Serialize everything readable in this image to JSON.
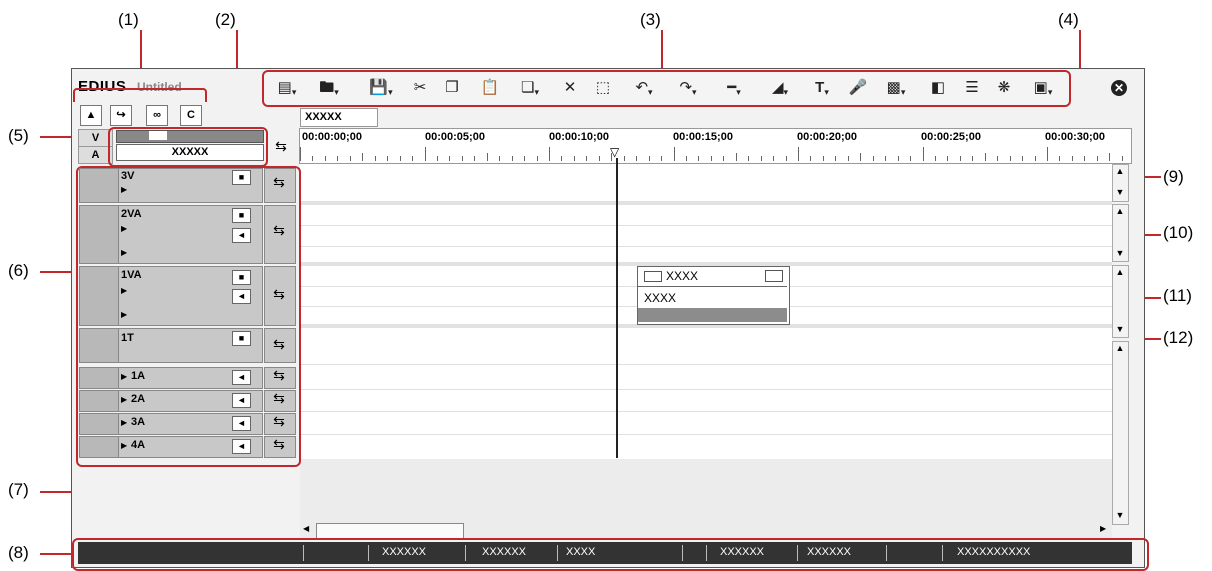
{
  "callouts": [
    "(1)",
    "(2)",
    "(3)",
    "(4)",
    "(5)",
    "(6)",
    "(7)",
    "(8)",
    "(9)",
    "(10)",
    "(11)",
    "(12)"
  ],
  "window": {
    "app_title": "EDIUS",
    "subtitle": "Untitled"
  },
  "sequence_tab": "XXXXX",
  "patch": {
    "v_label": "V",
    "a_label": "A",
    "source_name": "XXXXX"
  },
  "ruler_timecodes": [
    "00:00:00;00",
    "00:00:05;00",
    "00:00:10;00",
    "00:00:15;00",
    "00:00:20;00",
    "00:00:25;00",
    "00:00:30;00"
  ],
  "tracks": [
    {
      "name": "3V"
    },
    {
      "name": "2VA"
    },
    {
      "name": "1VA"
    },
    {
      "name": "1T"
    },
    {
      "name": "1A"
    },
    {
      "name": "2A"
    },
    {
      "name": "3A"
    },
    {
      "name": "4A"
    }
  ],
  "clip": {
    "name": "XXXX",
    "label": "XXXX"
  },
  "status_bar": [
    "XXXXXX",
    "XXXXXX",
    "XXXX",
    "XXXXXX",
    "XXXXXX",
    "XXXXXXXXXX"
  ],
  "colors": {
    "callout_red": "#c0282b",
    "status_bg": "#333333",
    "clip_bar": "#8c8c8c"
  }
}
